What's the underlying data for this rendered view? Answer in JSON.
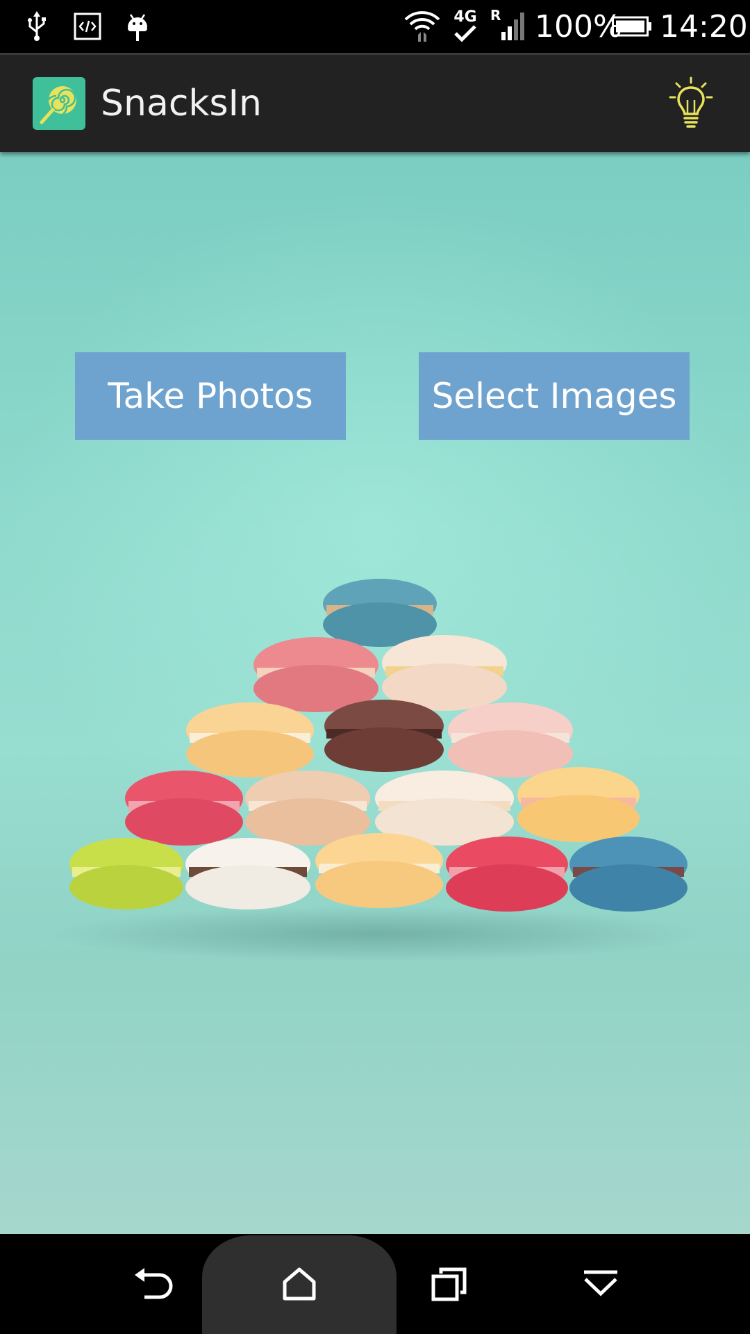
{
  "status_bar": {
    "network_type": "4G",
    "roaming_label": "R",
    "battery_percent": "100%",
    "time": "14:20",
    "icons": [
      "usb-icon",
      "debug-code-icon",
      "android-notification-icon",
      "wifi-icon",
      "4g-icon",
      "signal-roaming-icon",
      "battery-icon"
    ]
  },
  "app_bar": {
    "title": "SnacksIn",
    "logo_icon": "lollipop-logo-icon",
    "action_icon": "lightbulb-icon"
  },
  "main": {
    "buttons": [
      {
        "label": "Take Photos"
      },
      {
        "label": "Select Images"
      }
    ],
    "background_image": "macarons-pyramid"
  },
  "nav_bar": {
    "icons": [
      "back-icon",
      "home-icon",
      "recents-icon",
      "hide-nav-icon"
    ]
  },
  "colors": {
    "status_bar": "#000000",
    "app_bar": "#222222",
    "button_bg": "#6fa3cf",
    "content_bg": "#8fdacd",
    "logo_bg": "#3fbf9a",
    "accent_yellow": "#e8e35a"
  }
}
